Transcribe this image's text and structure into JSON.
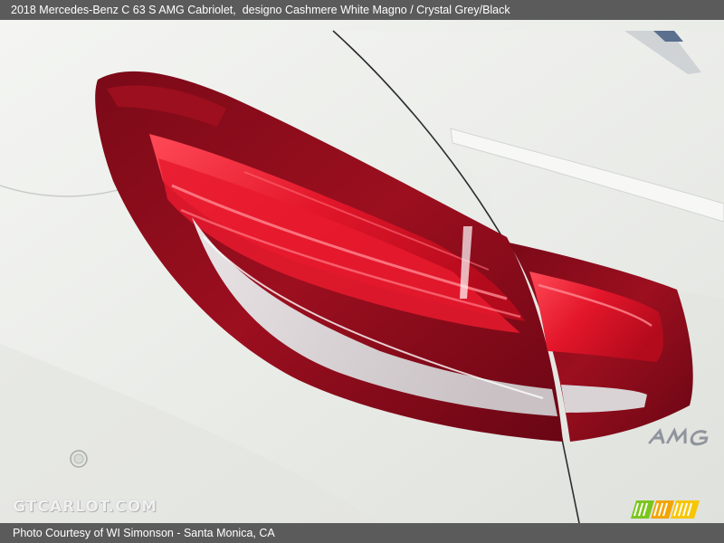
{
  "header": {
    "vehicle": "2018 Mercedes-Benz C 63 S AMG Cabriolet,",
    "paint": "designo Cashmere White Magno / Crystal Grey/Black"
  },
  "photo": {
    "subject": "tail-light",
    "badge_text": "AMG"
  },
  "watermark": {
    "text": "GTCARLOT.COM"
  },
  "footer": {
    "credit": "Photo Courtesy of WI Simonson - Santa Monica, CA"
  },
  "colors": {
    "bar_background": "#5b5b5b",
    "body_paint": "#eceeea",
    "tail_light_red": "#d0101e",
    "logo_green": "#7bc61e",
    "logo_orange": "#f2a500"
  }
}
